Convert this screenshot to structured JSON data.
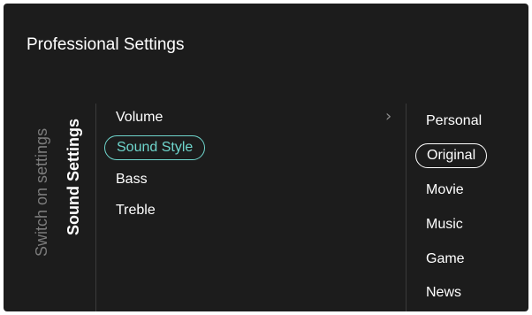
{
  "header": {
    "title": "Professional Settings"
  },
  "side_tabs": [
    {
      "label": "Switch on settings",
      "active": false
    },
    {
      "label": "Sound Settings",
      "active": true
    }
  ],
  "menu": {
    "items": [
      {
        "label": "Volume",
        "selected": false,
        "has_submenu": true
      },
      {
        "label": "Sound Style",
        "selected": true
      },
      {
        "label": "Bass",
        "selected": false
      },
      {
        "label": "Treble",
        "selected": false
      }
    ],
    "submenu_icon": "chevron-right-icon"
  },
  "options": {
    "items": [
      {
        "label": "Personal",
        "selected": false
      },
      {
        "label": "Original",
        "selected": true
      },
      {
        "label": "Movie",
        "selected": false
      },
      {
        "label": "Music",
        "selected": false
      },
      {
        "label": "Game",
        "selected": false
      },
      {
        "label": "News",
        "selected": false
      }
    ]
  },
  "colors": {
    "background": "#1c1c1c",
    "accent": "#6fd6cd",
    "inactive_text": "#7c7c7c"
  }
}
